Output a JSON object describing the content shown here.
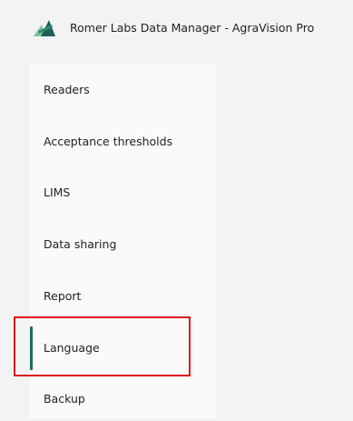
{
  "window": {
    "title": "Romer Labs Data Manager - AgraVision Pro",
    "logo_icon": "romer-labs-logo-icon"
  },
  "sidebar": {
    "items": [
      {
        "label": "Readers",
        "selected": false
      },
      {
        "label": "Acceptance thresholds",
        "selected": false
      },
      {
        "label": "LIMS",
        "selected": false
      },
      {
        "label": "Data sharing",
        "selected": false
      },
      {
        "label": "Report",
        "selected": false
      },
      {
        "label": "Language",
        "selected": true
      },
      {
        "label": "Backup",
        "selected": false
      }
    ]
  },
  "colors": {
    "accent": "#1b6b63",
    "highlight": "#e0161f",
    "logo_dark": "#1f5f57",
    "logo_light": "#7ec49a"
  }
}
